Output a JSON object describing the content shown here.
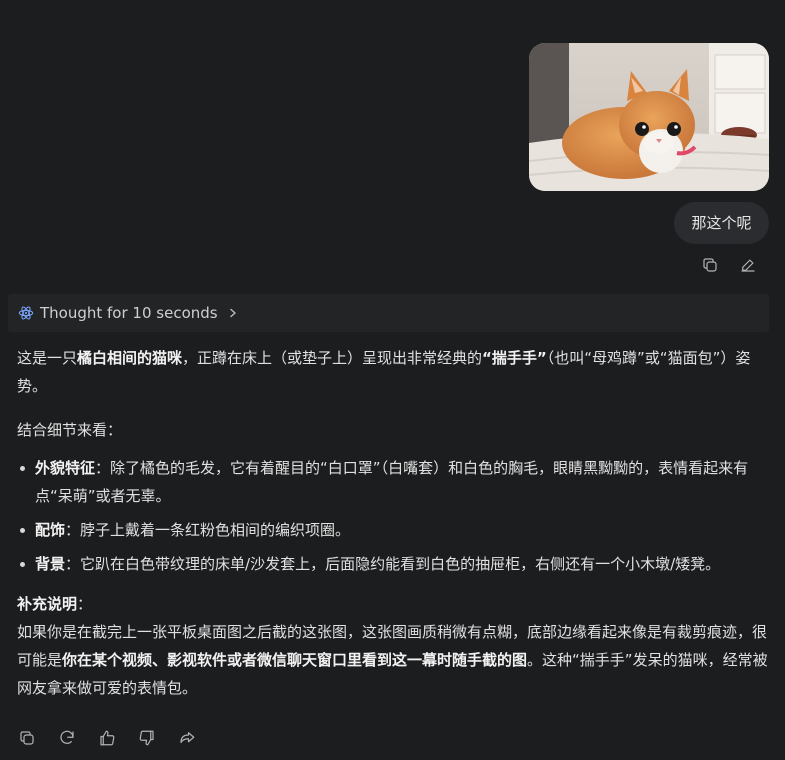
{
  "user_message": {
    "image_alt": "orange tabby cat loafing on bed",
    "text": "那这个呢"
  },
  "user_actions": {
    "icons": [
      "copy-icon",
      "edit-icon"
    ]
  },
  "thought": {
    "label": "Thought for 10 seconds",
    "icon": "atom-icon"
  },
  "answer": {
    "p1": {
      "t1": "这是一只",
      "b1": "橘白相间的猫咪",
      "t2": "，正蹲在床上（或垫子上）呈现出非常经典的",
      "b2": "“揣手手”",
      "t3": "（也叫“母鸡蹲”或“猫面包”）姿势。"
    },
    "p2": "结合细节来看：",
    "bullets": [
      {
        "label": "外貌特征",
        "sep": "：",
        "text": "除了橘色的毛发，它有着醒目的“白口罩”（白嘴套）和白色的胸毛，眼睛黑黝黝的，表情看起来有点“呆萌”或者无辜。"
      },
      {
        "label": "配饰",
        "sep": "：",
        "text": "脖子上戴着一条红粉色相间的编织项圈。"
      },
      {
        "label": "背景",
        "sep": "：",
        "text": "它趴在白色带纹理的床单/沙发套上，后面隐约能看到白色的抽屉柜，右侧还有一个小木墩/矮凳。"
      }
    ],
    "supplement": {
      "heading": "补充说明",
      "colon": "：",
      "t1": "如果你是在截完上一张平板桌面图之后截的这张图，这张图画质稍微有点糊，底部边缘看起来像是有裁剪痕迹，很可能是",
      "b1": "你在某个视频、影视软件或者微信聊天窗口里看到这一幕时随手截的图",
      "t2": "。这种“揣手手”发呆的猫咪，经常被网友拿来做可爱的表情包。"
    }
  },
  "bottom_actions": {
    "icons": [
      "copy-icon",
      "regenerate-icon",
      "thumbs-up-icon",
      "thumbs-down-icon",
      "share-icon"
    ]
  },
  "colors": {
    "background": "#1c1d1f",
    "bubble": "#2b2c2f",
    "thought_bar": "#232426",
    "atom_accent": "#7aa7ff"
  }
}
